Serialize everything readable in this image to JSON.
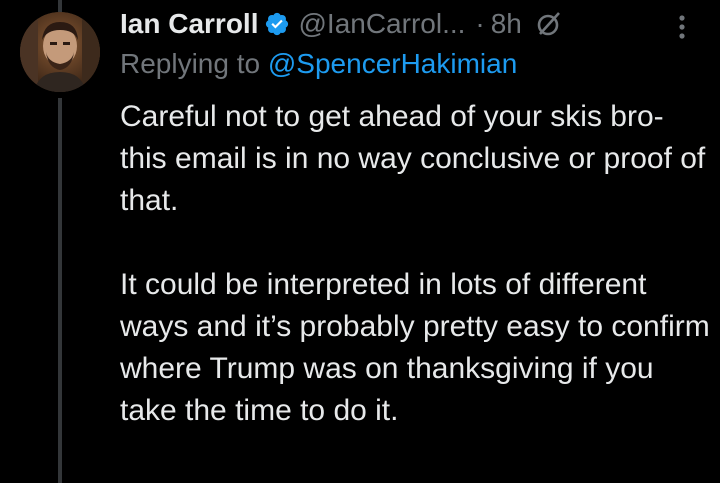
{
  "tweet": {
    "author": {
      "display_name": "Ian Carroll",
      "handle": "@IanCarrol...",
      "verified": true,
      "avatar_icon": "avatar-photo"
    },
    "separator": "·",
    "time": "8h",
    "replying_prefix": "Replying to ",
    "replying_to": "@SpencerHakimian",
    "paragraphs": [
      "Careful not to get ahead of your skis bro- this email is in no way conclusive or proof of that.",
      "It could be interpreted in lots of different ways and it’s probably pretty easy to confirm where Trump was on thanksgiving if you take the time to do it."
    ]
  },
  "colors": {
    "background": "#000000",
    "text_primary": "#e7e9ea",
    "text_secondary": "#71767b",
    "accent": "#1d9bf0",
    "thread_line": "#333639"
  },
  "icons": [
    "verified-badge-icon",
    "grok-icon",
    "more-options-icon"
  ]
}
